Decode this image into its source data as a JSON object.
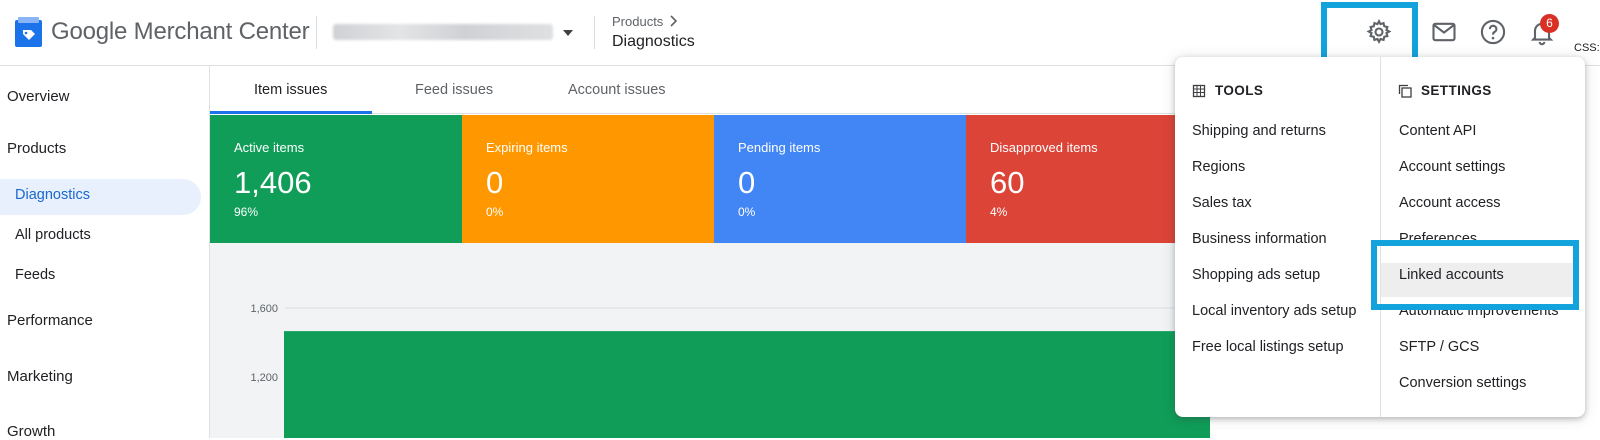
{
  "header": {
    "brand": "Google Merchant Center",
    "breadcrumb_parent": "Products",
    "breadcrumb_current": "Diagnostics",
    "notification_count": "6",
    "truncated_label": "CSS:"
  },
  "sidebar": {
    "items": [
      {
        "label": "Overview"
      },
      {
        "label": "Products"
      },
      {
        "label": "Diagnostics"
      },
      {
        "label": "All products"
      },
      {
        "label": "Feeds"
      },
      {
        "label": "Performance"
      },
      {
        "label": "Marketing"
      },
      {
        "label": "Growth"
      }
    ]
  },
  "tabs": [
    {
      "label": "Item issues",
      "active": true
    },
    {
      "label": "Feed issues",
      "active": false
    },
    {
      "label": "Account issues",
      "active": false
    }
  ],
  "tiles": [
    {
      "title": "Active items",
      "value": "1,406",
      "pct": "96%",
      "color": "#0f9d58"
    },
    {
      "title": "Expiring items",
      "value": "0",
      "pct": "0%",
      "color": "#ff9800"
    },
    {
      "title": "Pending items",
      "value": "0",
      "pct": "0%",
      "color": "#4285f4"
    },
    {
      "title": "Disapproved items",
      "value": "60",
      "pct": "4%",
      "color": "#db4437"
    }
  ],
  "chart_data": {
    "type": "bar",
    "y_ticks": [
      "1,600",
      "1,200"
    ],
    "series": [
      {
        "values": [
          1466
        ]
      }
    ],
    "ylim": [
      0,
      1600
    ],
    "color": "#0f9d58"
  },
  "dropdown": {
    "tools_heading": "TOOLS",
    "settings_heading": "SETTINGS",
    "tools": [
      "Shipping and returns",
      "Regions",
      "Sales tax",
      "Business information",
      "Shopping ads setup",
      "Local inventory ads setup",
      "Free local listings setup"
    ],
    "settings": [
      "Content API",
      "Account settings",
      "Account access",
      "Preferences",
      "Linked accounts",
      "Automatic improvements",
      "SFTP / GCS",
      "Conversion settings"
    ],
    "highlighted_item": "Linked accounts"
  },
  "colors": {
    "accent": "#1a73e8",
    "annotation_box": "#12a3dc",
    "badge": "#d93025"
  },
  "icons": [
    "merchant-center-logo-icon",
    "caret-down-icon",
    "chevron-right-icon",
    "gear-icon",
    "mail-icon",
    "help-icon",
    "bell-icon",
    "tools-icon",
    "settings-icon"
  ]
}
